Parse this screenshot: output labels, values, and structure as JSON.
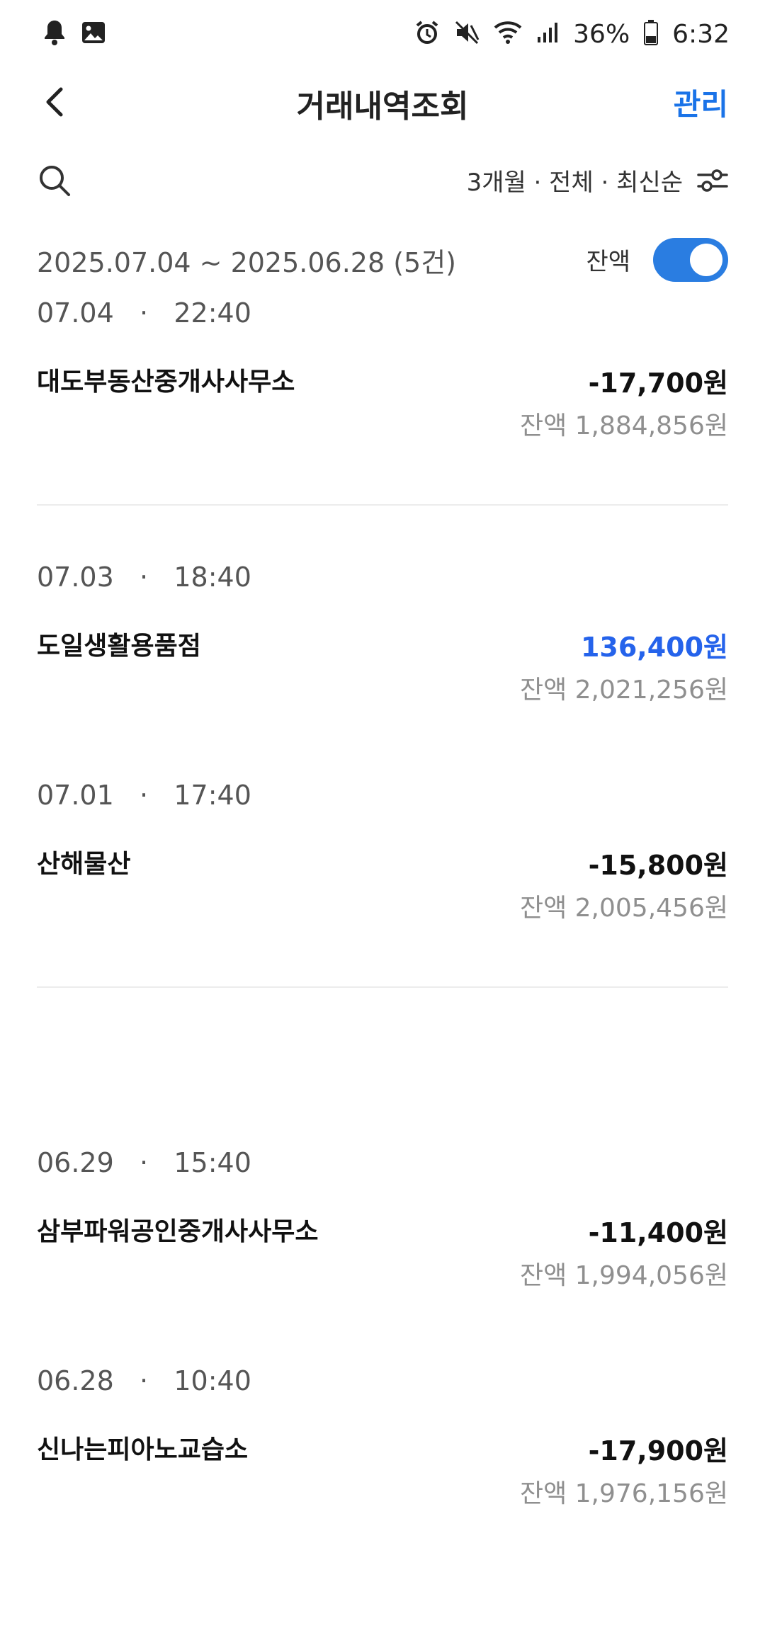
{
  "status_bar": {
    "battery": "36%",
    "time": "6:32",
    "left_icons": [
      "bell-icon",
      "image-icon"
    ],
    "right_icons": [
      "alarm-icon",
      "mute-icon",
      "wifi-icon",
      "signal-icon",
      "battery-icon"
    ]
  },
  "header": {
    "title": "거래내역조회",
    "manage_label": "관리"
  },
  "filter": {
    "summary": "3개월 · 전체 · 최신순"
  },
  "range": {
    "text": "2025.07.04 ~ 2025.06.28 (5건)",
    "balance_label": "잔액",
    "balance_toggle_on": true
  },
  "transactions": [
    {
      "date": "07.04",
      "time": "22:40",
      "name": "대도부동산중개사사무소",
      "amount": "-17,700원",
      "balance": "잔액 1,884,856원",
      "type": "debit"
    },
    {
      "date": "07.03",
      "time": "18:40",
      "name": "도일생활용품점",
      "amount": "136,400원",
      "balance": "잔액 2,021,256원",
      "type": "credit"
    },
    {
      "date": "07.01",
      "time": "17:40",
      "name": "산해물산",
      "amount": "-15,800원",
      "balance": "잔액 2,005,456원",
      "type": "debit"
    },
    {
      "date": "06.29",
      "time": "15:40",
      "name": "삼부파워공인중개사사무소",
      "amount": "-11,400원",
      "balance": "잔액 1,994,056원",
      "type": "debit"
    },
    {
      "date": "06.28",
      "time": "10:40",
      "name": "신나는피아노교습소",
      "amount": "-17,900원",
      "balance": "잔액 1,976,156원",
      "type": "debit"
    }
  ],
  "colors": {
    "accent": "#1a73e8",
    "credit": "#2563eb",
    "toggle": "#2a7de1",
    "muted": "#8f8f8f"
  }
}
